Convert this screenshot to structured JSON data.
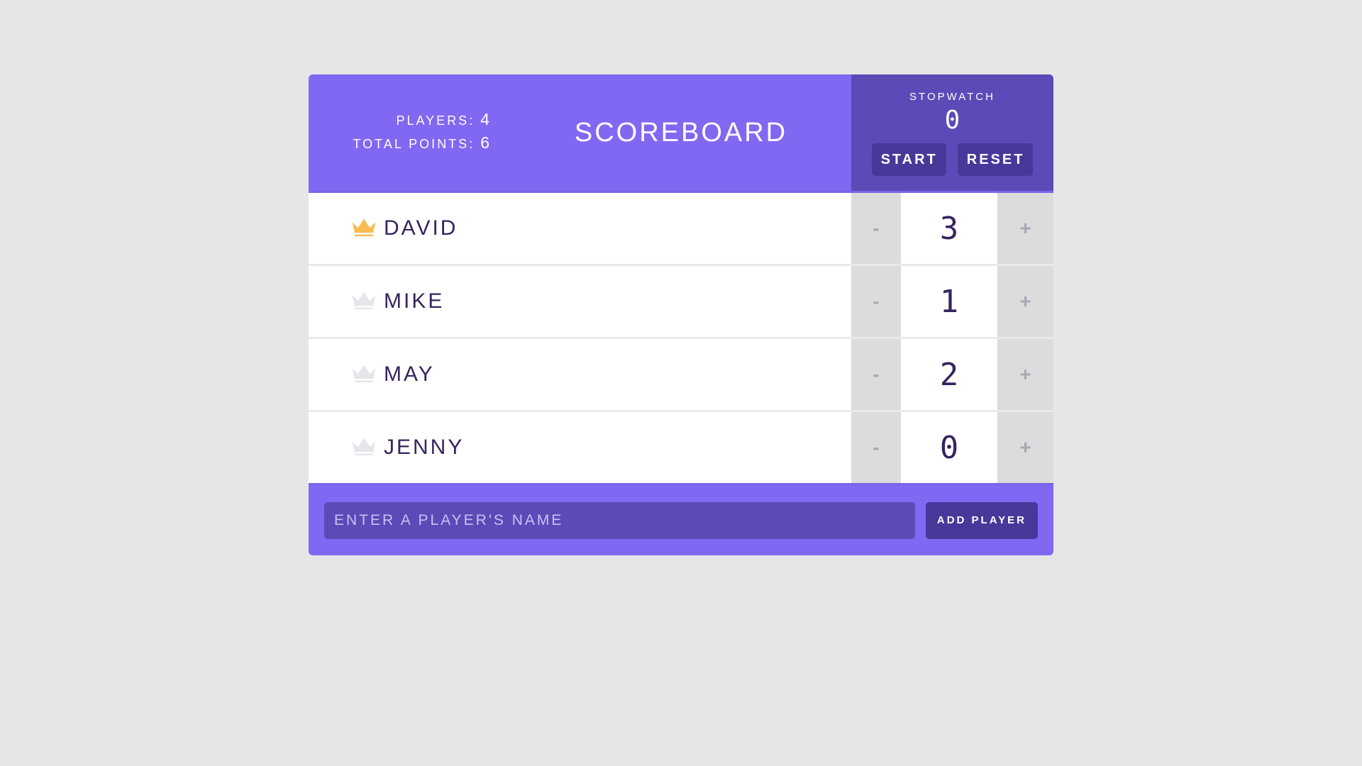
{
  "header": {
    "players_label": "PLAYERS:",
    "players_value": "4",
    "points_label": "TOTAL POINTS:",
    "points_value": "6",
    "title": "SCOREBOARD"
  },
  "stopwatch": {
    "label": "STOPWATCH",
    "time": "0",
    "start_label": "START",
    "reset_label": "RESET"
  },
  "players": [
    {
      "name": "DAVID",
      "score": "3",
      "minus": "-",
      "plus": "+",
      "leader": true
    },
    {
      "name": "MIKE",
      "score": "1",
      "minus": "-",
      "plus": "+",
      "leader": false
    },
    {
      "name": "MAY",
      "score": "2",
      "minus": "-",
      "plus": "+",
      "leader": false
    },
    {
      "name": "JENNY",
      "score": "0",
      "minus": "-",
      "plus": "+",
      "leader": false
    }
  ],
  "footer": {
    "input_placeholder": "ENTER A PLAYER'S NAME",
    "input_value": "",
    "add_label": "ADD PLAYER"
  },
  "colors": {
    "crown_leader": "#f9bc54",
    "crown_default": "#e6e6ea"
  },
  "icons": {
    "crown": "crown-icon"
  }
}
